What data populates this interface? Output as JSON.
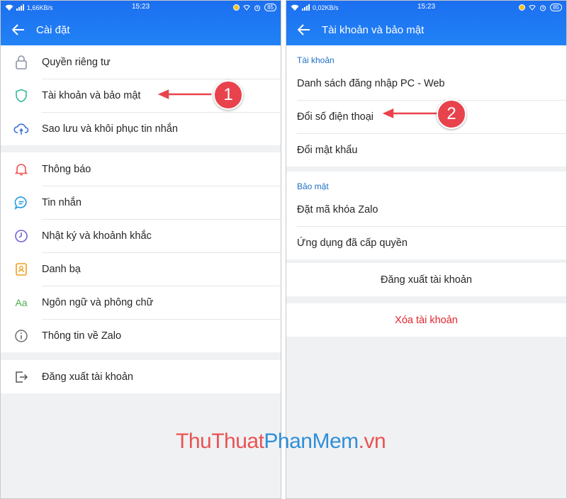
{
  "left": {
    "status": {
      "speed": "1,66KB/s",
      "time": "15:23",
      "battery": "85"
    },
    "title": "Cài đặt",
    "groups": [
      {
        "items": [
          {
            "label": "Quyền riêng tư",
            "icon": "lock-icon"
          },
          {
            "label": "Tài khoản và bảo mật",
            "icon": "shield-icon"
          },
          {
            "label": "Sao lưu và khôi phục tin nhắn",
            "icon": "cloud-sync-icon"
          }
        ]
      },
      {
        "items": [
          {
            "label": "Thông báo",
            "icon": "bell-icon"
          },
          {
            "label": "Tin nhắn",
            "icon": "chat-bubble-icon"
          },
          {
            "label": "Nhật ký và khoảnh khắc",
            "icon": "clock-icon"
          },
          {
            "label": "Danh bạ",
            "icon": "contacts-icon"
          },
          {
            "label": "Ngôn ngữ và phông chữ",
            "icon": "font-icon"
          },
          {
            "label": "Thông tin về Zalo",
            "icon": "info-icon"
          }
        ]
      },
      {
        "items": [
          {
            "label": "Đăng xuất tài khoản",
            "icon": "logout-icon"
          }
        ]
      }
    ],
    "font_icon_text": "Aa",
    "callout": "1"
  },
  "right": {
    "status": {
      "speed": "0,02KB/s",
      "time": "15:23",
      "battery": "85"
    },
    "title": "Tài khoản và bảo mật",
    "section_account": "Tài khoản",
    "account_items": [
      "Danh sách đăng nhập PC - Web",
      "Đổi số điện thoại",
      "Đổi mật khẩu"
    ],
    "section_security": "Bảo mật",
    "security_items": [
      "Đặt mã khóa Zalo",
      "Ứng dụng đã cấp quyền"
    ],
    "logout": "Đăng xuất tài khoản",
    "delete": "Xóa tài khoản",
    "callout": "2"
  },
  "watermark": {
    "part1": "ThuThuat",
    "part2": "PhanMem",
    "part3": ".vn"
  },
  "colors": {
    "header": "#1e77f2",
    "callout": "#e8424c",
    "delete_text": "#e0262d",
    "section_text": "#1f6fc4",
    "shield": "#35b89a",
    "bell": "#ef5350",
    "chat": "#1e9ae0",
    "clock": "#6c63d9",
    "contacts": "#f0a020",
    "font": "#4cae4f"
  }
}
